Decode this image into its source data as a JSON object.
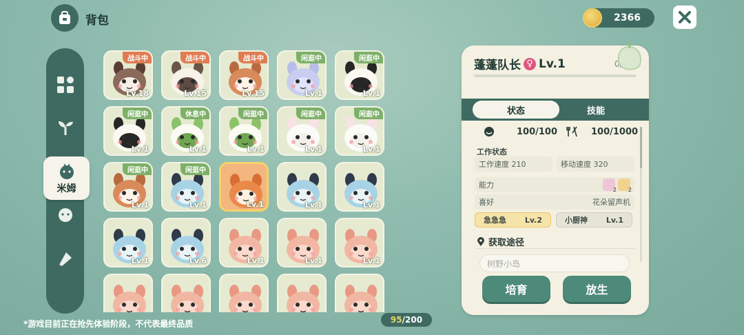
{
  "header": {
    "title": "背包",
    "coins": "2366"
  },
  "sidebar": {
    "active_label": "米姆"
  },
  "grid": {
    "count_current": "95",
    "count_total": "/200",
    "cells": [
      {
        "badge": "战斗中",
        "badge_type": "fight",
        "level": "Lv.18",
        "species": "raccoon"
      },
      {
        "badge": "战斗中",
        "badge_type": "fight",
        "level": "Lv.15",
        "species": "sheep"
      },
      {
        "badge": "战斗中",
        "badge_type": "fight",
        "level": "Lv.15",
        "species": "bird"
      },
      {
        "badge": "闲逛中",
        "badge_type": "idle",
        "level": "Lv.1",
        "species": "elephant"
      },
      {
        "badge": "闲逛中",
        "badge_type": "idle",
        "level": "Lv.1",
        "species": "panda"
      },
      {
        "badge": "闲逛中",
        "badge_type": "idle",
        "level": "Lv.1",
        "species": "panda"
      },
      {
        "badge": "休息中",
        "badge_type": "rest",
        "level": "Lv.1",
        "species": "leaf"
      },
      {
        "badge": "闲逛中",
        "badge_type": "idle",
        "level": "Lv.1",
        "species": "leaf"
      },
      {
        "badge": "闲逛中",
        "badge_type": "idle",
        "level": "Lv.1",
        "species": "rabbit"
      },
      {
        "badge": "闲逛中",
        "badge_type": "idle",
        "level": "Lv.1",
        "species": "rabbit"
      },
      {
        "badge": "闲逛中",
        "badge_type": "idle",
        "level": "Lv.1",
        "species": "bird"
      },
      {
        "badge": "闲逛中",
        "badge_type": "idle",
        "level": "Lv.1",
        "species": "cat"
      },
      {
        "badge": "",
        "badge_type": "",
        "level": "Lv.1",
        "species": "fox",
        "selected": true
      },
      {
        "badge": "",
        "badge_type": "",
        "level": "Lv.1",
        "species": "cat"
      },
      {
        "badge": "",
        "badge_type": "",
        "level": "Lv.1",
        "species": "cat"
      },
      {
        "badge": "",
        "badge_type": "",
        "level": "Lv.1",
        "species": "cat"
      },
      {
        "badge": "",
        "badge_type": "",
        "level": "Lv.6",
        "species": "cat"
      },
      {
        "badge": "",
        "badge_type": "",
        "level": "Lv.1",
        "species": "monkey"
      },
      {
        "badge": "",
        "badge_type": "",
        "level": "Lv.1",
        "species": "monkey"
      },
      {
        "badge": "",
        "badge_type": "",
        "level": "Lv.1",
        "species": "monkey"
      },
      {
        "badge": "",
        "badge_type": "",
        "level": "",
        "species": "monkey"
      },
      {
        "badge": "",
        "badge_type": "",
        "level": "",
        "species": "monkey"
      },
      {
        "badge": "",
        "badge_type": "",
        "level": "",
        "species": "monkey"
      },
      {
        "badge": "",
        "badge_type": "",
        "level": "",
        "species": "monkey"
      },
      {
        "badge": "",
        "badge_type": "",
        "level": "",
        "species": "monkey"
      }
    ]
  },
  "footnote": "*游戏目前正在抢先体验阶段，不代表最终品质",
  "detail": {
    "name": "蓬蓬队长",
    "gender_symbol": "♀",
    "level": "Lv.1",
    "xp": "0/10",
    "xp_fraction": 0,
    "tabs": [
      "状态",
      "技能"
    ],
    "hp": "100/100",
    "stamina": "100/1000",
    "work_status_title": "工作状态",
    "work_speed_label": "工作速度",
    "work_speed": "210",
    "move_speed_label": "移动速度",
    "move_speed": "320",
    "ability_label": "能力",
    "ability_badge_1": "2",
    "ability_badge_2": "2",
    "hobby_label": "喜好",
    "hobby_value": "花朵留声机",
    "traits": [
      {
        "name": "急急急",
        "level": "Lv.2"
      },
      {
        "name": "小厨神",
        "level": "Lv.1"
      }
    ],
    "acquire_title": "获取途径",
    "acquire_source": "树野小岛",
    "btn_train": "培育",
    "btn_release": "放生"
  },
  "colors": {
    "accent": "#3f6a61",
    "fight_badge": "#e07c52",
    "idle_badge": "#7db068",
    "button": "#4d8a79",
    "female": "#e0557e"
  }
}
